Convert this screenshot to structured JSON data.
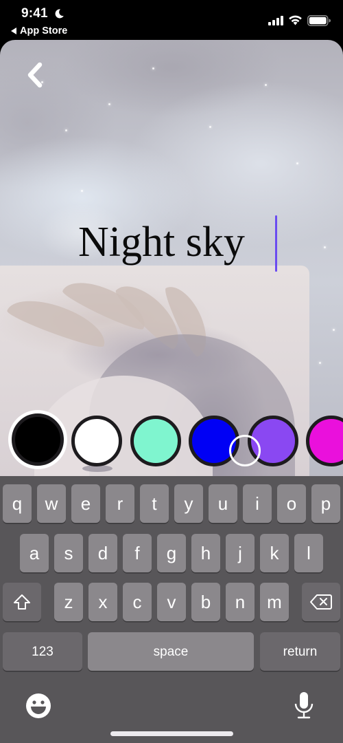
{
  "status_bar": {
    "time": "9:41",
    "back_app_label": "App Store",
    "focus_icon": "moon-icon",
    "signal_icon": "cellular-signal-icon",
    "wifi_icon": "wifi-icon",
    "battery_icon": "battery-icon"
  },
  "editor": {
    "back_icon": "chevron-left-icon",
    "title_text": "Night sky",
    "cursor_color": "#6a4cf0"
  },
  "color_picker": {
    "swatches": [
      {
        "name": "black",
        "color": "#000000",
        "selected": true
      },
      {
        "name": "white",
        "color": "#ffffff",
        "selected": false
      },
      {
        "name": "mint",
        "color": "#7ff5cf",
        "selected": false
      },
      {
        "name": "blue",
        "color": "#0000f5",
        "selected": false
      },
      {
        "name": "purple",
        "color": "#8a48f2",
        "selected": false
      },
      {
        "name": "magenta",
        "color": "#ea10dc",
        "selected": false
      }
    ]
  },
  "keyboard": {
    "row1": [
      "q",
      "w",
      "e",
      "r",
      "t",
      "y",
      "u",
      "i",
      "o",
      "p"
    ],
    "row2": [
      "a",
      "s",
      "d",
      "f",
      "g",
      "h",
      "j",
      "k",
      "l"
    ],
    "row3": [
      "z",
      "x",
      "c",
      "v",
      "b",
      "n",
      "m"
    ],
    "shift_icon": "shift-icon",
    "delete_icon": "delete-backspace-icon",
    "numbers_label": "123",
    "space_label": "space",
    "return_label": "return",
    "emoji_icon": "emoji-icon",
    "mic_icon": "microphone-icon"
  }
}
